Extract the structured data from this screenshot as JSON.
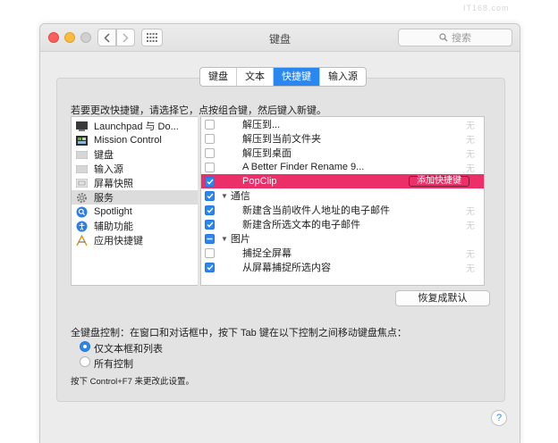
{
  "watermark": "IT168.com",
  "window": {
    "title": "键盘"
  },
  "search": {
    "placeholder": "搜索"
  },
  "tabs": [
    {
      "label": "键盘",
      "active": false
    },
    {
      "label": "文本",
      "active": false
    },
    {
      "label": "快捷键",
      "active": true
    },
    {
      "label": "输入源",
      "active": false
    }
  ],
  "instruction": "若要更改快捷键，请选择它，点按组合键，然后键入新键。",
  "categories": [
    {
      "label": "Launchpad 与 Do...",
      "icon": "launchpad-icon"
    },
    {
      "label": "Mission Control",
      "icon": "mission-control-icon"
    },
    {
      "label": "键盘",
      "icon": "keyboard-icon"
    },
    {
      "label": "输入源",
      "icon": "input-source-icon"
    },
    {
      "label": "屏幕快照",
      "icon": "screenshot-icon"
    },
    {
      "label": "服务",
      "icon": "services-gear-icon",
      "selected": true
    },
    {
      "label": "Spotlight",
      "icon": "spotlight-icon"
    },
    {
      "label": "辅助功能",
      "icon": "accessibility-icon"
    },
    {
      "label": "应用快捷键",
      "icon": "app-shortcuts-icon"
    }
  ],
  "items": [
    {
      "label": "解压到...",
      "checked": false,
      "shortcut": "无"
    },
    {
      "label": "解压到当前文件夹",
      "checked": false,
      "shortcut": "无"
    },
    {
      "label": "解压到桌面",
      "checked": false,
      "shortcut": "无"
    },
    {
      "label": "A Better Finder Rename 9...",
      "checked": false,
      "shortcut": "无"
    },
    {
      "label": "PopClip",
      "checked": true,
      "highlighted": true,
      "button": "添加快捷键"
    },
    {
      "label": "通信",
      "group": true,
      "checked": true
    },
    {
      "label": "新建含当前收件人地址的电子邮件",
      "checked": true,
      "shortcut": "无"
    },
    {
      "label": "新建含所选文本的电子邮件",
      "checked": true,
      "shortcut": "无"
    },
    {
      "label": "图片",
      "group": true,
      "partial": true
    },
    {
      "label": "捕捉全屏幕",
      "checked": false,
      "shortcut": "无"
    },
    {
      "label": "从屏幕捕捉所选内容",
      "checked": true,
      "shortcut": "无"
    }
  ],
  "restore_button": "恢复成默认",
  "full_keyboard": {
    "label": "全键盘控制：在窗口和对话框中，按下 Tab 键在以下控制之间移动键盘焦点：",
    "options": [
      {
        "label": "仅文本框和列表",
        "selected": true
      },
      {
        "label": "所有控制",
        "selected": false
      }
    ],
    "hint": "按下 Control+F7 来更改此设置。"
  },
  "help_label": "?",
  "colors": {
    "accent": "#2b87f0",
    "highlight": "#ec2f68"
  }
}
